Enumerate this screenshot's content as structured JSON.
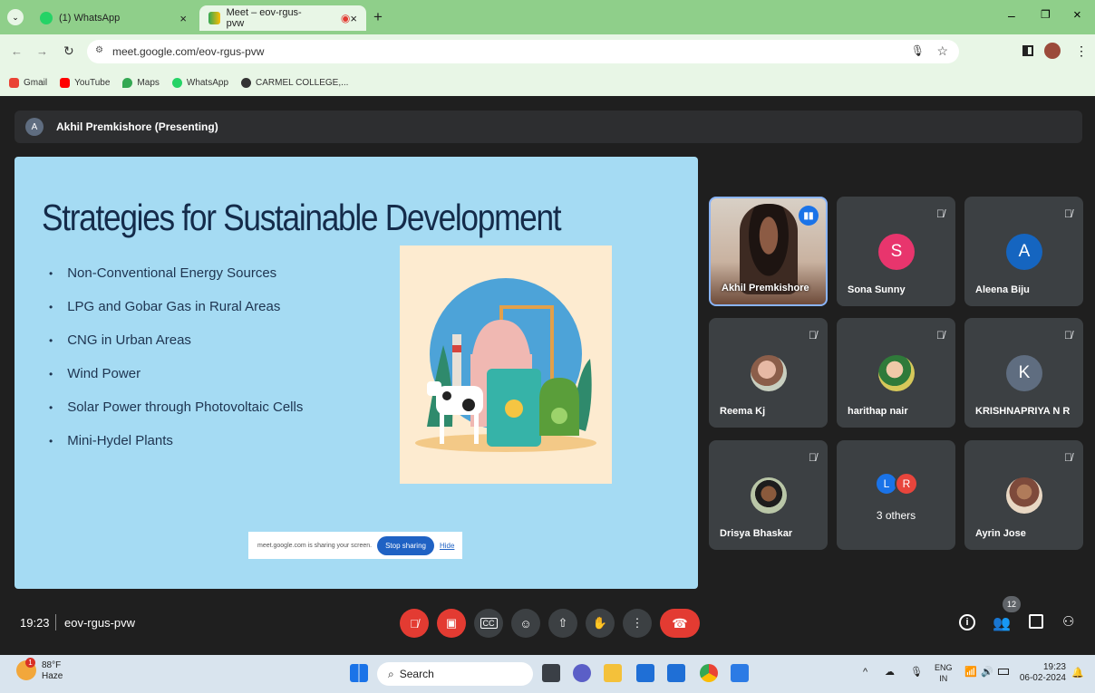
{
  "browser": {
    "tabs": [
      {
        "label": "(1) WhatsApp"
      },
      {
        "label": "Meet – eov-rgus-pvw"
      }
    ],
    "url": "meet.google.com/eov-rgus-pvw",
    "bookmarks": [
      "Gmail",
      "YouTube",
      "Maps",
      "WhatsApp",
      "CARMEL COLLEGE,..."
    ]
  },
  "meet": {
    "presenter_bar": "Akhil Premkishore (Presenting)",
    "presenter_initial": "A",
    "slide": {
      "title": "Strategies for Sustainable Development",
      "bullets": [
        "Non-Conventional Energy Sources",
        "LPG and Gobar Gas in Rural Areas",
        "CNG in Urban Areas",
        "Wind Power",
        "Solar Power through Photovoltaic Cells",
        "Mini-Hydel Plants"
      ]
    },
    "share_banner": {
      "text": "meet.google.com is sharing your screen.",
      "stop": "Stop sharing",
      "hide": "Hide"
    },
    "participants": [
      {
        "name": "Akhil Premkishore"
      },
      {
        "name": "Sona Sunny",
        "initial": "S",
        "color": "#e8356d"
      },
      {
        "name": "Aleena Biju",
        "initial": "A",
        "color": "#1565c0"
      },
      {
        "name": "Reema Kj"
      },
      {
        "name": "harithap nair"
      },
      {
        "name": "KRISHNAPRIYA N R",
        "initial": "K",
        "color": "#5f6d80"
      },
      {
        "name": "Drisya Bhaskar"
      },
      {
        "name": "3 others",
        "initials": [
          "L",
          "R"
        ]
      },
      {
        "name": "Ayrin Jose"
      }
    ],
    "time": "19:23",
    "meeting_code": "eov-rgus-pvw",
    "people_count": "12"
  },
  "taskbar": {
    "weather_temp": "88°F",
    "weather_desc": "Haze",
    "weather_badge": "1",
    "search": "Search",
    "lang_top": "ENG",
    "lang_bottom": "IN",
    "clock_time": "19:23",
    "clock_date": "06-02-2024"
  }
}
